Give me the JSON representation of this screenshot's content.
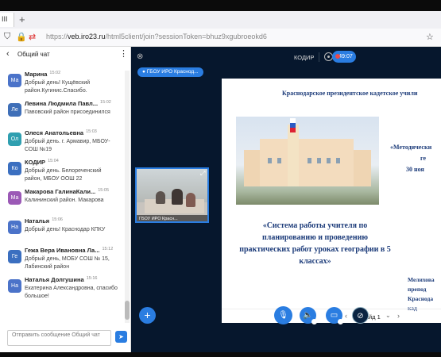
{
  "browser": {
    "tab_label": "III",
    "new_tab": "+",
    "url_prefix": "https://",
    "url_domain": "veb.iro23.ru",
    "url_path": "/html5client/join?sessionToken=bhuz9xgubroeokd6"
  },
  "chat": {
    "title": "Общий чат",
    "input_placeholder": "Отправить сообщение Общий чат",
    "messages": [
      {
        "initials": "Ма",
        "name": "Марина",
        "time": "15:02",
        "text": "Добрый день! Кущёвский район.Кугинис.Спасибо.",
        "color": "#4b73c9"
      },
      {
        "initials": "Ле",
        "name": "Левина Людмила Павл...",
        "time": "15:02",
        "text": "Павовский район присоединился",
        "color": "#3f6fb8"
      },
      {
        "initials": "Ол",
        "name": "Олеся Анатольевна",
        "time": "15:03",
        "text": "Добрый день. г. Армавир, МБОУ-СОШ №19",
        "color": "#2f9fb0"
      },
      {
        "initials": "Ко",
        "name": "КОДИР",
        "time": "15:04",
        "text": "Добрый день. Белореченский район, МБОУ ООШ 22",
        "color": "#3b6fc0"
      },
      {
        "initials": "Ма",
        "name": "Макарова ГалинаКали...",
        "time": "15:05",
        "text": "Калининский район. Макарова",
        "color": "#9b59b6"
      },
      {
        "initials": "На",
        "name": "Наталья",
        "time": "15:06",
        "text": "Добрый день! Краснодар КПКУ",
        "color": "#4b73c9"
      },
      {
        "initials": "Ге",
        "name": "Гежа Вера Ивановна Ла...",
        "time": "15:12",
        "text": "Добрый день, МОБУ СОШ № 15, Лабинский район",
        "color": "#3b6fc0"
      },
      {
        "initials": "На",
        "name": "Наталья Долгушина",
        "time": "15:16",
        "text": "Екатерина Александровна, спасибо большое!",
        "color": "#4b73c9"
      }
    ]
  },
  "conference": {
    "room_name": "КОДИР",
    "timer": "49:07",
    "talker": "ГБОУ ИРО Краснод...",
    "webcam_caption": "ГБОУ ИРО Красн...",
    "slide_label": "Слайд 1"
  },
  "slide": {
    "header": "Краснодарское президентское кадетское учили",
    "right1": "«Методически",
    "right2": "ге",
    "right3": "30 ноя",
    "main": "«Система работы учителя по планированию и проведению практических работ уроках географии в 5 классах»",
    "author1": "Мелихова",
    "author2": "препод",
    "author3": "Краснода",
    "author4": "кад"
  },
  "colors": {
    "accent": "#2a7de1",
    "background": "#06172d",
    "slide_text": "#1d3c7a"
  }
}
